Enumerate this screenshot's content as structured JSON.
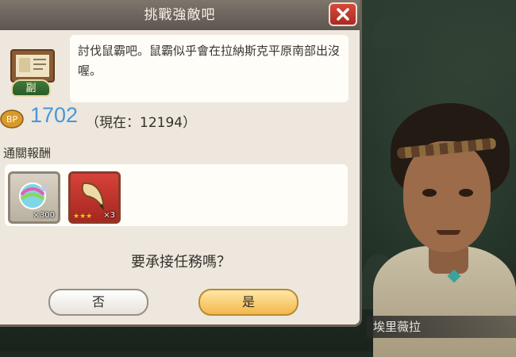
{
  "dialog": {
    "title": "挑戰強敵吧",
    "close_icon": "close-icon",
    "quest_tag": "副",
    "description": "討伐鼠霸吧。鼠霸似乎會在拉納斯克平原南部出沒喔。",
    "bp": {
      "icon_label": "BP",
      "required": "1702",
      "current_text": "（現在：12194）"
    },
    "reward_label": "通關報酬",
    "rewards": [
      {
        "icon": "crystal-item-icon",
        "qty": "×300"
      },
      {
        "icon": "horn-item-icon",
        "qty": "×3",
        "stars": "★★★"
      }
    ],
    "question": "要承接任務嗎？",
    "buttons": {
      "no": "否",
      "yes": "是"
    }
  },
  "character": {
    "name": "埃里薇拉"
  },
  "colors": {
    "bp_value": "#4a96d8",
    "yes_button": "#f3b84a",
    "close_button": "#d7493a"
  }
}
